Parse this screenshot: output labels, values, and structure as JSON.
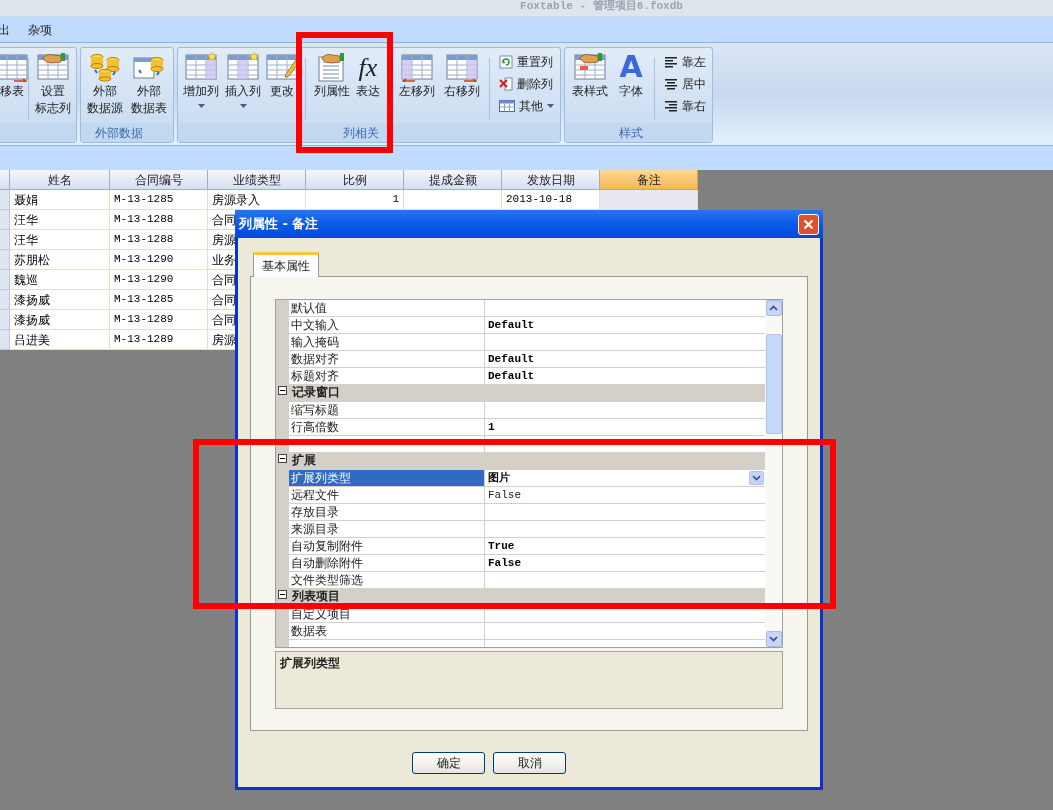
{
  "window": {
    "title": "Foxtable - 管理项目6.foxdb"
  },
  "menu": [
    {
      "label": "出"
    },
    {
      "label": "杂项"
    }
  ],
  "ribbon_groups": [
    {
      "items": [
        {
          "kind": "large",
          "lines": [
            "移表"
          ],
          "has_menu": false
        },
        {
          "kind": "divider"
        },
        {
          "kind": "large",
          "lines": [
            "设置",
            "标志列"
          ],
          "has_menu": false
        }
      ]
    },
    {
      "label": "外部数据",
      "items": [
        {
          "kind": "large",
          "lines": [
            "外部",
            "数据源"
          ],
          "has_menu": false
        },
        {
          "kind": "large",
          "lines": [
            "外部",
            "数据表"
          ],
          "has_menu": false
        }
      ]
    },
    {
      "label": "列相关",
      "items": [
        {
          "kind": "large",
          "lines": [
            "增加列"
          ],
          "has_menu": true
        },
        {
          "kind": "large",
          "lines": [
            "插入列"
          ],
          "has_menu": true
        },
        {
          "kind": "large",
          "lines": [
            "更改"
          ],
          "has_menu": false
        },
        {
          "kind": "divider"
        },
        {
          "kind": "large",
          "lines": [
            "列属性"
          ],
          "has_menu": false
        },
        {
          "kind": "large",
          "lines": [
            "表达"
          ],
          "glyph": "fx",
          "has_menu": false
        },
        {
          "kind": "divider"
        },
        {
          "kind": "large",
          "lines": [
            "左移列"
          ],
          "has_menu": false
        },
        {
          "kind": "large",
          "lines": [
            "右移列"
          ],
          "has_menu": false
        },
        {
          "kind": "divider"
        },
        {
          "kind": "stack",
          "buttons": [
            {
              "label": "重置列",
              "has_menu": false
            },
            {
              "label": "删除列",
              "has_menu": false
            },
            {
              "label": "其他",
              "has_menu": true
            }
          ]
        }
      ]
    },
    {
      "label": "样式",
      "items": [
        {
          "kind": "large",
          "lines": [
            "表样式"
          ],
          "has_menu": false
        },
        {
          "kind": "large",
          "lines": [
            "字体"
          ],
          "glyph": "A",
          "has_menu": false
        },
        {
          "kind": "divider"
        },
        {
          "kind": "stack",
          "buttons": [
            {
              "label": "靠左",
              "has_menu": false
            },
            {
              "label": "居中",
              "has_menu": false
            },
            {
              "label": "靠右",
              "has_menu": false
            }
          ]
        }
      ]
    }
  ],
  "table": {
    "columns": [
      {
        "label": "姓名",
        "selected": false
      },
      {
        "label": "合同编号",
        "selected": false
      },
      {
        "label": "业绩类型",
        "selected": false
      },
      {
        "label": "比例",
        "selected": false
      },
      {
        "label": "提成金额",
        "selected": false
      },
      {
        "label": "发放日期",
        "selected": false
      },
      {
        "label": "备注",
        "selected": true
      }
    ],
    "rows": [
      [
        "聂娟",
        "M-13-1285",
        "房源录入",
        "1",
        null,
        "2013-10-18",
        null
      ],
      [
        "汪华",
        "M-13-1288",
        "合同"
      ],
      [
        "汪华",
        "M-13-1288",
        "房源"
      ],
      [
        "苏朋松",
        "M-13-1290",
        "业务"
      ],
      [
        "魏巡",
        "M-13-1290",
        "合同"
      ],
      [
        "漆扬威",
        "M-13-1285",
        "合同"
      ],
      [
        "漆扬威",
        "M-13-1289",
        "合同"
      ],
      [
        "吕进美",
        "M-13-1289",
        "房源"
      ]
    ]
  },
  "dialog": {
    "title": "列属性 - 备注",
    "tabs": [
      {
        "label": "基本属性",
        "selected": true
      }
    ],
    "properties": [
      {
        "kind": "property",
        "name": "默认值",
        "selected": false
      },
      {
        "kind": "property",
        "name": "中文输入",
        "value": "Default",
        "modified": true,
        "selected": false
      },
      {
        "kind": "property",
        "name": "输入掩码",
        "selected": false
      },
      {
        "kind": "property",
        "name": "数据对齐",
        "value": "Default",
        "modified": true,
        "selected": false
      },
      {
        "kind": "property",
        "name": "标题对齐",
        "value": "Default",
        "modified": true,
        "selected": false
      },
      {
        "kind": "category",
        "name": "记录窗口",
        "expanded": true
      },
      {
        "kind": "property",
        "name": "缩写标题",
        "selected": false
      },
      {
        "kind": "property",
        "name": "行高倍数",
        "value": "1",
        "modified": true,
        "selected": false
      },
      {
        "kind": "property",
        "selected": false
      },
      {
        "kind": "category",
        "name": "扩展",
        "expanded": true
      },
      {
        "kind": "property",
        "name": "扩展列类型",
        "value": "图片",
        "modified": true,
        "selected": true
      },
      {
        "kind": "property",
        "name": "远程文件",
        "value": "False",
        "modified": false,
        "selected": false
      },
      {
        "kind": "property",
        "name": "存放目录",
        "selected": false
      },
      {
        "kind": "property",
        "name": "来源目录",
        "selected": false
      },
      {
        "kind": "property",
        "name": "自动复制附件",
        "value": "True",
        "modified": true,
        "selected": false
      },
      {
        "kind": "property",
        "name": "自动删除附件",
        "value": "False",
        "modified": true,
        "selected": false
      },
      {
        "kind": "property",
        "name": "文件类型筛选",
        "selected": false
      },
      {
        "kind": "category",
        "name": "列表项目",
        "expanded": true
      },
      {
        "kind": "property",
        "name": "自定义项目",
        "selected": false
      },
      {
        "kind": "property",
        "name": "数据表",
        "selected": false
      },
      {
        "kind": "property",
        "selected": false
      }
    ],
    "description": "扩展列类型",
    "buttons": [
      {
        "label": "确定"
      },
      {
        "label": "取消"
      }
    ]
  }
}
